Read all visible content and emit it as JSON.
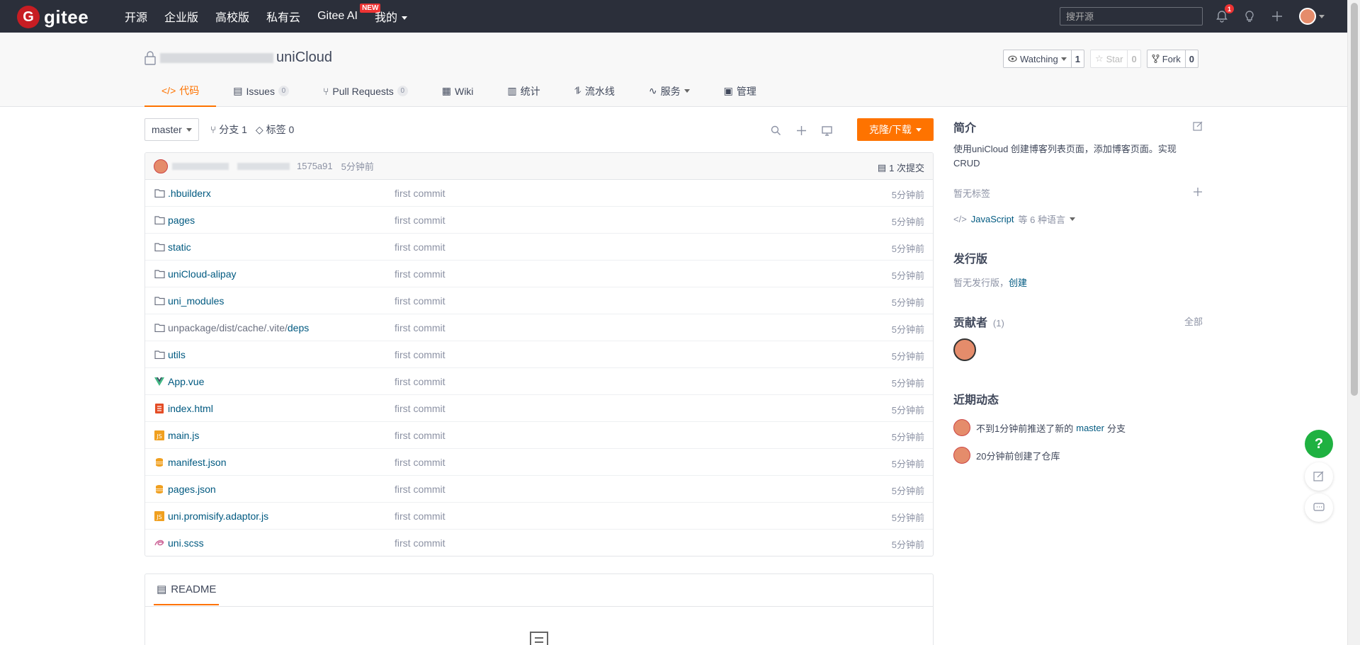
{
  "nav": {
    "logo_letter": "G",
    "logo_text": "gitee",
    "links": [
      "开源",
      "企业版",
      "高校版",
      "私有云",
      "Gitee AI",
      "我的"
    ],
    "new_badge": "NEW",
    "search_placeholder": "搜开源",
    "notification_count": "1"
  },
  "repo": {
    "title_suffix": "uniCloud",
    "watching_label": "Watching",
    "watching_count": "1",
    "star_label": "Star",
    "star_count": "0",
    "fork_label": "Fork",
    "fork_count": "0",
    "tabs": [
      {
        "label": "代码",
        "icon": "code-icon"
      },
      {
        "label": "Issues",
        "count": "0",
        "icon": "issues-icon"
      },
      {
        "label": "Pull Requests",
        "count": "0",
        "icon": "pr-icon"
      },
      {
        "label": "Wiki",
        "icon": "wiki-icon"
      },
      {
        "label": "统计",
        "icon": "chart-icon"
      },
      {
        "label": "流水线",
        "icon": "pipeline-icon"
      },
      {
        "label": "服务",
        "icon": "service-icon"
      },
      {
        "label": "管理",
        "icon": "manage-icon"
      }
    ]
  },
  "branch": {
    "current": "master",
    "branches_label": "分支 1",
    "tags_label": "标签 0",
    "clone_label": "克隆/下载"
  },
  "commit": {
    "hash": "1575a91",
    "time": "5分钟前",
    "count_label": "1 次提交"
  },
  "files": [
    {
      "name": ".hbuilderx",
      "type": "folder",
      "msg": "first commit",
      "time": "5分钟前"
    },
    {
      "name": "pages",
      "type": "folder",
      "msg": "first commit",
      "time": "5分钟前"
    },
    {
      "name": "static",
      "type": "folder",
      "msg": "first commit",
      "time": "5分钟前"
    },
    {
      "name": "uniCloud-alipay",
      "type": "folder",
      "msg": "first commit",
      "time": "5分钟前"
    },
    {
      "name": "uni_modules",
      "type": "folder",
      "msg": "first commit",
      "time": "5分钟前"
    },
    {
      "name_prefix": "unpackage/dist/cache/.vite/",
      "name": "deps",
      "type": "folder",
      "msg": "first commit",
      "time": "5分钟前"
    },
    {
      "name": "utils",
      "type": "folder",
      "msg": "first commit",
      "time": "5分钟前"
    },
    {
      "name": "App.vue",
      "type": "vue",
      "msg": "first commit",
      "time": "5分钟前"
    },
    {
      "name": "index.html",
      "type": "html",
      "msg": "first commit",
      "time": "5分钟前"
    },
    {
      "name": "main.js",
      "type": "js",
      "msg": "first commit",
      "time": "5分钟前"
    },
    {
      "name": "manifest.json",
      "type": "json",
      "msg": "first commit",
      "time": "5分钟前"
    },
    {
      "name": "pages.json",
      "type": "json",
      "msg": "first commit",
      "time": "5分钟前"
    },
    {
      "name": "uni.promisify.adaptor.js",
      "type": "js",
      "msg": "first commit",
      "time": "5分钟前"
    },
    {
      "name": "uni.scss",
      "type": "scss",
      "msg": "first commit",
      "time": "5分钟前"
    }
  ],
  "readme": {
    "label": "README"
  },
  "sidebar": {
    "intro_title": "简介",
    "intro_desc": "使用uniCloud 创建博客列表页面，添加博客页面。实现CRUD",
    "no_tags": "暂无标签",
    "lang_name": "JavaScript",
    "lang_more": "等 6 种语言",
    "release_title": "发行版",
    "release_none": "暂无发行版，",
    "release_create": "创建",
    "contrib_title": "贡献者",
    "contrib_count": "(1)",
    "contrib_all": "全部",
    "activity_title": "近期动态",
    "activity_1_pre": "不到1分钟前推送了新的",
    "activity_1_branch": "master",
    "activity_1_post": "分支",
    "activity_2": "20分钟前创建了仓库"
  },
  "colors": {
    "accent": "#fe7300",
    "nav_bg": "#2b2f3a",
    "link": "#005980",
    "help_green": "#1fb141"
  }
}
